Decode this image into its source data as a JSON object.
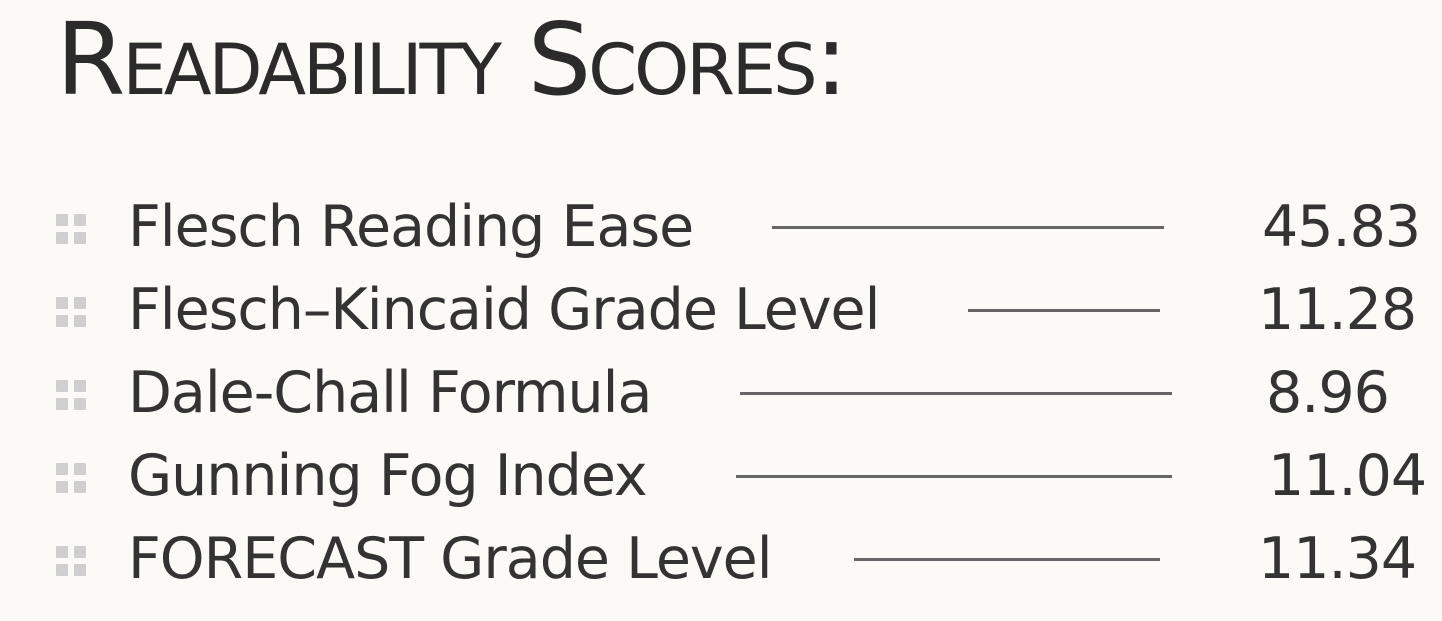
{
  "title": "Readability Scores:",
  "scores": [
    {
      "name": "Flesch Reading Ease",
      "value": "45.83"
    },
    {
      "name": "Flesch–Kincaid Grade Level",
      "value": "11.28"
    },
    {
      "name": "Dale-Chall Formula",
      "value": "8.96"
    },
    {
      "name": "Gunning Fog Index",
      "value": "11.04"
    },
    {
      "name": "FORECAST Grade Level",
      "value": "11.34"
    }
  ]
}
